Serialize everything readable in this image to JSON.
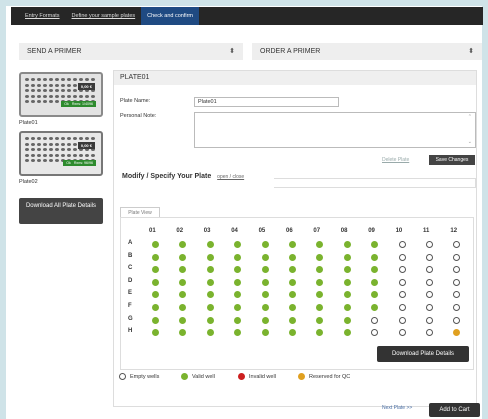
{
  "steps": [
    {
      "label": "Entry Formats"
    },
    {
      "label": "Define your sample plates"
    },
    {
      "label": "Check and confirm"
    }
  ],
  "selectors": {
    "left": "SEND A PRIMER",
    "right": "ORDER A PRIMER"
  },
  "plates": [
    {
      "label": "Plate01",
      "price": "0,00 €",
      "ok": "Ok",
      "rxns": "Rxns: 1/4096"
    },
    {
      "label": "Plate02",
      "price": "0,00 €",
      "ok": "Ok",
      "rxns": "Rxns: 96/96"
    }
  ],
  "download_all_label": "Download All Plate Details",
  "panel": {
    "title": "PLATE01",
    "plate_name_label": "Plate Name:",
    "plate_name_value": "Plate01",
    "personal_note_label": "Personal Note:",
    "personal_note_value": "",
    "delete_label": "Delete Plate",
    "save_label": "Save Changes",
    "modify_title": "Modify / Specify Your Plate",
    "open_close": "open / close",
    "plate_view_tab": "Plate View",
    "download_details_label": "Download Plate Details"
  },
  "grid": {
    "columns": [
      "01",
      "02",
      "03",
      "04",
      "05",
      "06",
      "07",
      "08",
      "09",
      "10",
      "11",
      "12"
    ],
    "rows": [
      {
        "label": "A",
        "wells": [
          "valid",
          "valid",
          "valid",
          "valid",
          "valid",
          "valid",
          "valid",
          "valid",
          "valid",
          "empty",
          "empty",
          "empty"
        ]
      },
      {
        "label": "B",
        "wells": [
          "valid",
          "valid",
          "valid",
          "valid",
          "valid",
          "valid",
          "valid",
          "valid",
          "valid",
          "empty",
          "empty",
          "empty"
        ]
      },
      {
        "label": "C",
        "wells": [
          "valid",
          "valid",
          "valid",
          "valid",
          "valid",
          "valid",
          "valid",
          "valid",
          "valid",
          "empty",
          "empty",
          "empty"
        ]
      },
      {
        "label": "D",
        "wells": [
          "valid",
          "valid",
          "valid",
          "valid",
          "valid",
          "valid",
          "valid",
          "valid",
          "valid",
          "empty",
          "empty",
          "empty"
        ]
      },
      {
        "label": "E",
        "wells": [
          "valid",
          "valid",
          "valid",
          "valid",
          "valid",
          "valid",
          "valid",
          "valid",
          "valid",
          "empty",
          "empty",
          "empty"
        ]
      },
      {
        "label": "F",
        "wells": [
          "valid",
          "valid",
          "valid",
          "valid",
          "valid",
          "valid",
          "valid",
          "valid",
          "valid",
          "empty",
          "empty",
          "empty"
        ]
      },
      {
        "label": "G",
        "wells": [
          "valid",
          "valid",
          "valid",
          "valid",
          "valid",
          "valid",
          "valid",
          "valid",
          "empty",
          "empty",
          "empty",
          "empty"
        ]
      },
      {
        "label": "H",
        "wells": [
          "valid",
          "valid",
          "valid",
          "valid",
          "valid",
          "valid",
          "valid",
          "valid",
          "empty",
          "empty",
          "empty",
          "qc"
        ]
      }
    ]
  },
  "legend": {
    "empty": "Empty wells",
    "valid": "Valid well",
    "invalid": "Invalid well",
    "qc": "Reserved for QC"
  },
  "colors": {
    "valid": "#7ab32e",
    "invalid": "#cc1f1f",
    "qc": "#e0a020",
    "active_step": "#1f4a82"
  },
  "footer": {
    "next_plate": "Next Plate >>",
    "add_to_cart": "Add to Cart"
  }
}
